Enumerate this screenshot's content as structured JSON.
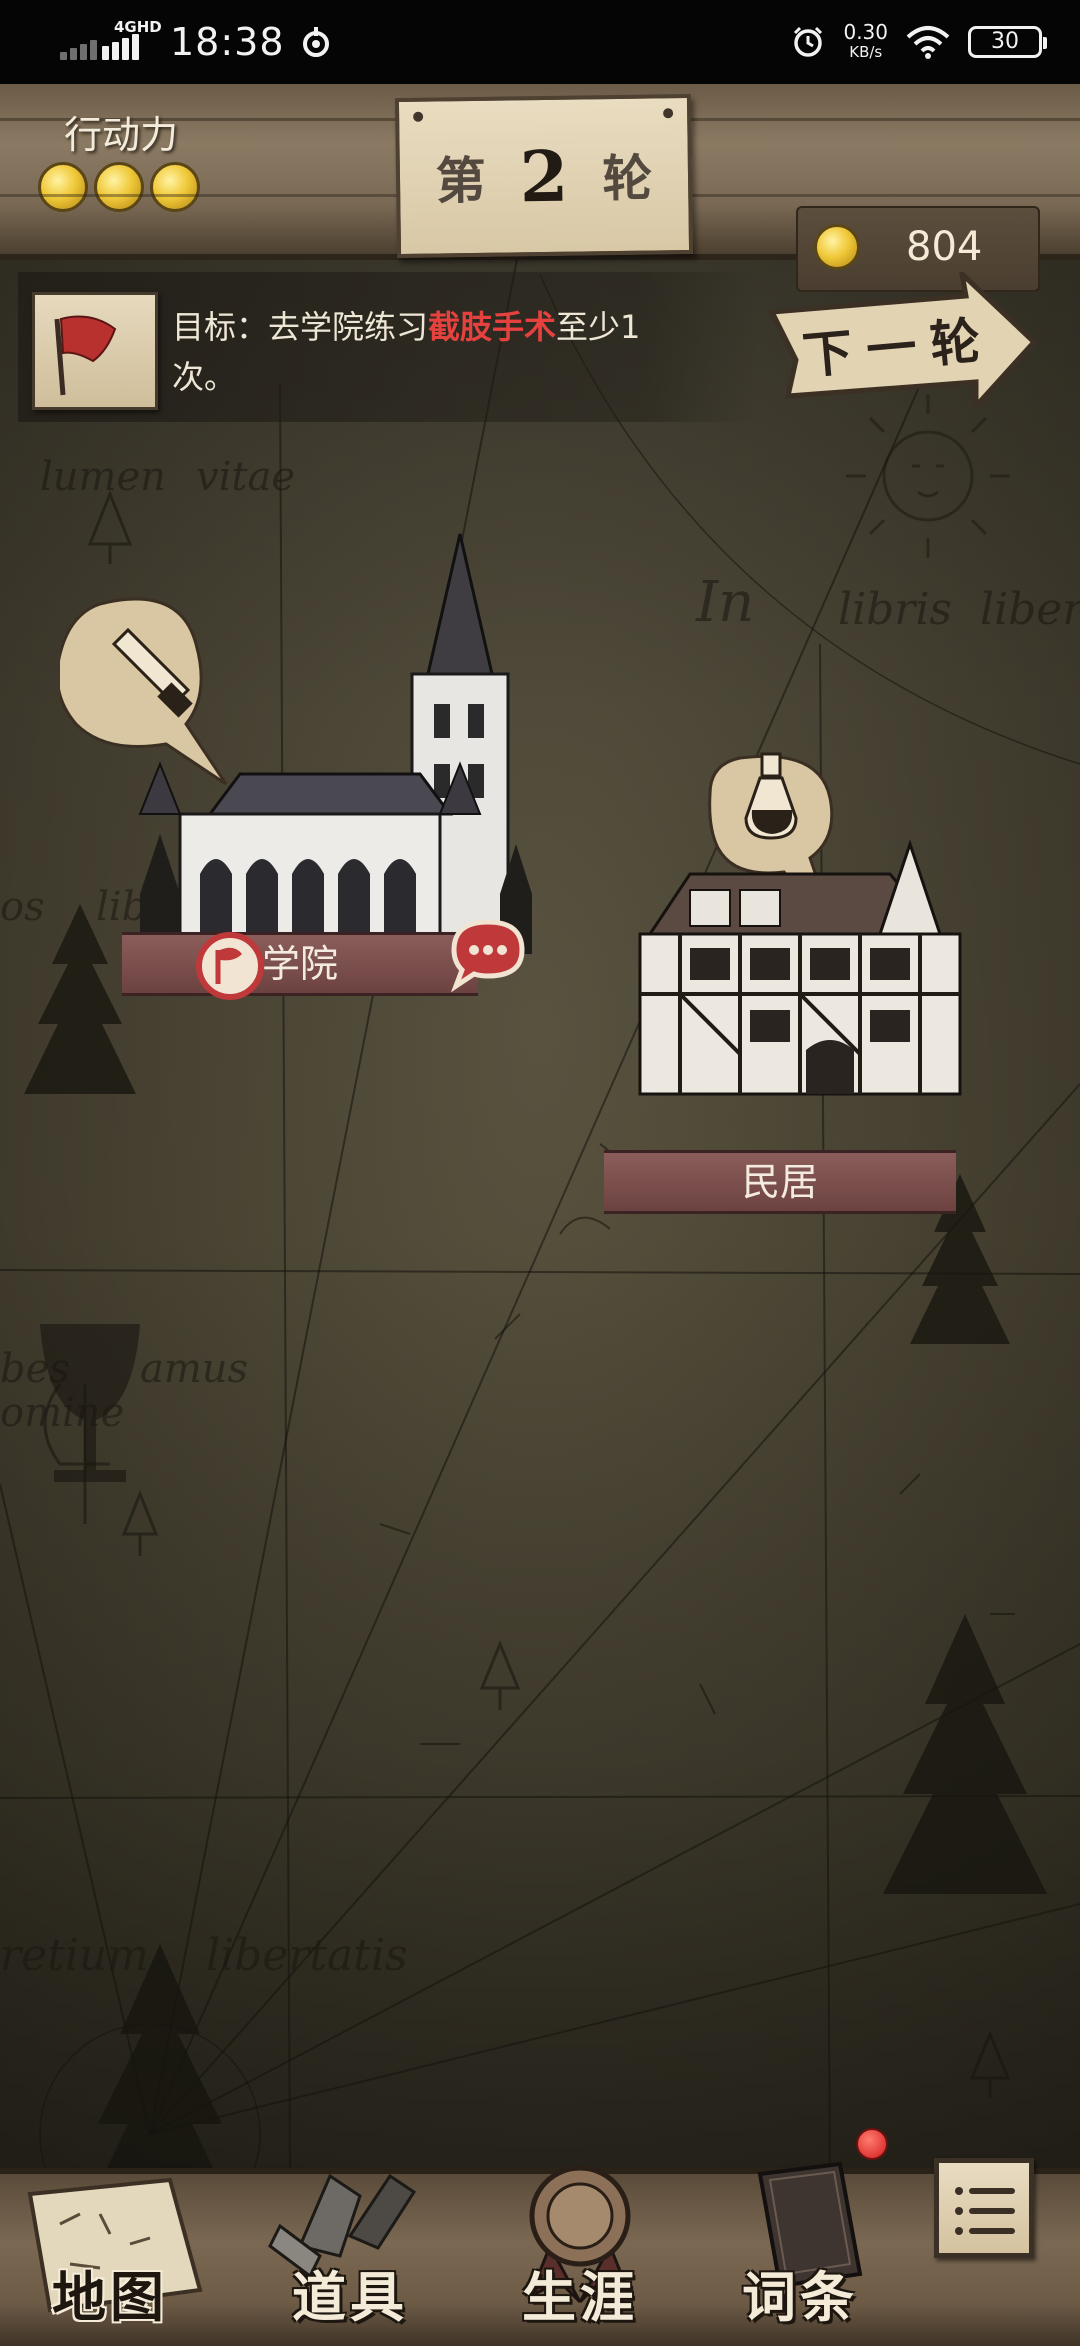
{
  "status_bar": {
    "network": "4GHD",
    "time": "18:38",
    "speed_value": "0.30",
    "speed_unit": "KB/s",
    "battery": "30"
  },
  "header": {
    "action_points_label": "行动力",
    "action_points": 3,
    "round_prefix": "第",
    "round_number": "2",
    "round_suffix": "轮",
    "money": "804"
  },
  "objective": {
    "prefix": "目标：去学院练习",
    "highlight": "截肢手术",
    "suffix": "至少1次。",
    "highlight_color": "#e5413e"
  },
  "next_round_label": "下一轮",
  "map": {
    "script_texts": [
      "lumen",
      "vitae",
      "In",
      "libris",
      "libert",
      "os",
      "liber",
      "bes",
      "amus",
      "omine",
      "retium",
      "libertatis"
    ],
    "locations": [
      {
        "name": "学院",
        "scroll_icon": "saw-icon",
        "badges": [
          "flag-badge-icon",
          "chat-bubble-icon"
        ]
      },
      {
        "name": "民居",
        "scroll_icon": "potion-icon",
        "badges": []
      }
    ]
  },
  "bottom_nav": {
    "items": [
      {
        "label": "地图",
        "icon": "map-icon",
        "active": true
      },
      {
        "label": "道具",
        "icon": "tools-icon",
        "active": false
      },
      {
        "label": "生涯",
        "icon": "medal-icon",
        "active": false
      },
      {
        "label": "词条",
        "icon": "book-icon",
        "active": false,
        "notification": true
      }
    ],
    "menu_icon": "list-menu-icon"
  }
}
